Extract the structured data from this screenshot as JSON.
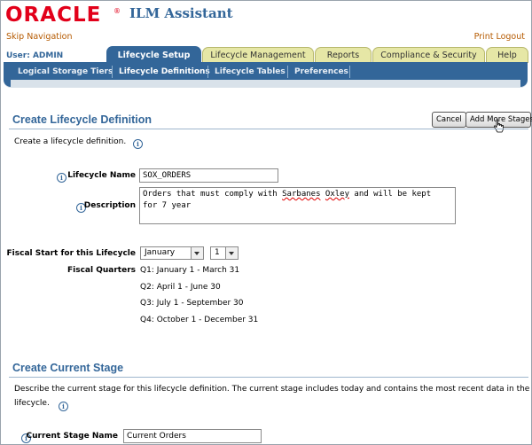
{
  "header": {
    "logo": "ORACLE",
    "logo_reg": "®",
    "product": "ILM Assistant",
    "skip_nav": "Skip Navigation",
    "print_logout": "Print Logout",
    "user": "User: ADMIN"
  },
  "tabs": [
    {
      "label": "Lifecycle Setup",
      "active": true
    },
    {
      "label": "Lifecycle Management",
      "active": false
    },
    {
      "label": "Reports",
      "active": false
    },
    {
      "label": "Compliance & Security",
      "active": false
    },
    {
      "label": "Help",
      "active": false
    }
  ],
  "subtabs": [
    {
      "label": "Logical Storage Tiers",
      "selected": false
    },
    {
      "label": "Lifecycle Definitions",
      "selected": true
    },
    {
      "label": "Lifecycle Tables",
      "selected": false
    },
    {
      "label": "Preferences",
      "selected": false
    }
  ],
  "definition": {
    "title": "Create Lifecycle Definition",
    "cancel_label": "Cancel",
    "add_stages_label": "Add More Stages",
    "intro": "Create a lifecycle definition.",
    "name_label": "Lifecycle Name",
    "name_value": "SOX_ORDERS",
    "desc_label": "Description",
    "desc_before": "Orders that must comply with ",
    "desc_word1": "Sarbanes",
    "desc_space": " ",
    "desc_word2": "Oxley",
    "desc_after": " and will be kept",
    "desc_line2": "for 7 year",
    "fiscal_label": "Fiscal Start for this Lifecycle",
    "fiscal_month": "January",
    "fiscal_day": "1",
    "quarters_label": "Fiscal Quarters",
    "quarters": [
      "Q1: January 1 - March 31",
      "Q2: April 1 - June 30",
      "Q3: July 1 - September 30",
      "Q4: October 1 - December 31"
    ]
  },
  "stage": {
    "title": "Create Current Stage",
    "intro_line1": "Describe the current stage for this lifecycle definition. The current stage includes today and contains the most recent data in the",
    "intro_line2": "lifecycle.",
    "name_label": "Current Stage Name",
    "name_value": "Current Orders"
  },
  "colors": {
    "brand_red": "#e2001a",
    "accent_blue": "#336699",
    "tab_inactive": "#e6e7a6",
    "link_orange": "#b55a00"
  },
  "icons": [
    "info-icon",
    "cursor-hand-icon",
    "dropdown-arrow-icon"
  ]
}
